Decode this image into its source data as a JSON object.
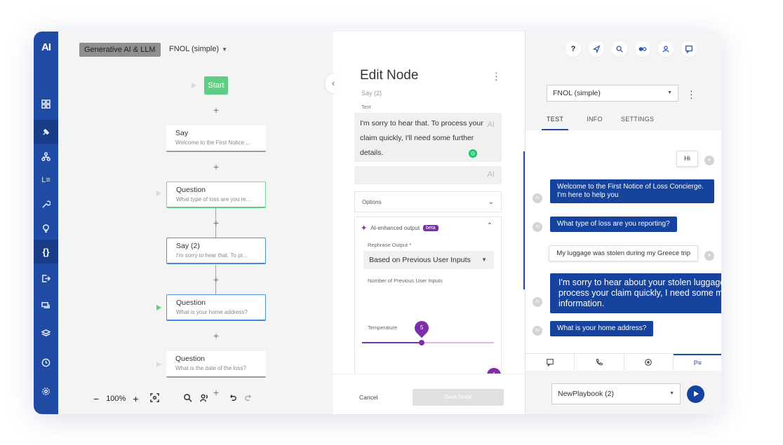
{
  "brand": {
    "logo": "AI",
    "accent": "#1f4ba5"
  },
  "rail": {
    "icons": [
      "grid-icon",
      "pin-icon",
      "network-icon",
      "list-icon",
      "wrench-icon",
      "bulb-icon",
      "braces-icon",
      "exit-icon",
      "chat-icon",
      "layers-icon",
      "clock-icon",
      "gear-icon"
    ],
    "braces_label": "{}",
    "list_label": "L≡"
  },
  "canvas": {
    "chip": "Generative AI & LLM",
    "flow": "FNOL (simple)",
    "start": "Start",
    "nodes": [
      {
        "title": "Say",
        "subtitle": "Welcome to the First Notice ..."
      },
      {
        "title": "Question",
        "subtitle": "What type of loss are you re..."
      },
      {
        "title": "Say (2)",
        "subtitle": "I'm sorry to hear that. To pr..."
      },
      {
        "title": "Question",
        "subtitle": "What is your home address?"
      },
      {
        "title": "Question",
        "subtitle": "What is the date of the loss?"
      }
    ],
    "zoom": "100%",
    "minus": "−",
    "plus": "+"
  },
  "edit": {
    "title": "Edit Node",
    "subtitle": "Say (2)",
    "text_label": "Text",
    "text_value": "I'm sorry to hear that. To process your claim quickly, I'll need some further details.",
    "ai_badge": "AI",
    "options_label": "Options",
    "ai_section": "AI-enhanced output",
    "beta": "beta",
    "rephrase_label": "Rephrase Output *",
    "rephrase_value": "Based on Previous User Inputs",
    "prev_inputs_label": "Number of Previous User Inputs",
    "prev_inputs_value": "5",
    "prev_inputs_fraction": 0.45,
    "temperature_label": "Temperature",
    "temperature_value": "1",
    "temperature_fraction": 1.0,
    "cancel": "Cancel",
    "save": "Save Node"
  },
  "right": {
    "playbook": "FNOL (simple)",
    "tabs": [
      "TEST",
      "INFO",
      "SETTINGS"
    ],
    "messages": [
      {
        "from": "user",
        "text": "Hi"
      },
      {
        "from": "bot",
        "text": "Welcome to the First Notice of Loss Concierge. I'm here to help you"
      },
      {
        "from": "bot",
        "text": "What type of loss are you reporting?"
      },
      {
        "from": "user",
        "text": "My luggage was stolen during my Greece trip"
      },
      {
        "from": "bot",
        "text": "I'm sorry to hear about your stolen luggage. To process your claim quickly, I need some more information."
      },
      {
        "from": "bot",
        "text": "What is your home address?"
      }
    ],
    "avatar_label": "AI",
    "modes_last": "P≡",
    "run_select": "NewPlaybook (2)",
    "help": "?"
  }
}
